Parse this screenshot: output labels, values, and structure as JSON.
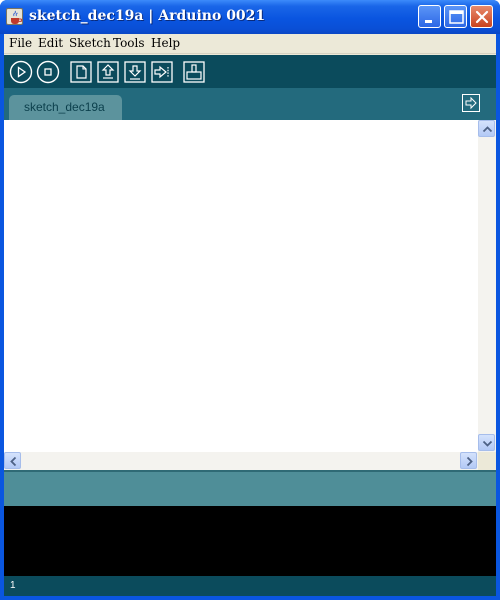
{
  "window": {
    "title": "sketch_dec19a | Arduino 0021"
  },
  "menu": {
    "items": [
      {
        "label": "File"
      },
      {
        "label": "Edit"
      },
      {
        "label": "Sketch"
      },
      {
        "label": "Tools"
      },
      {
        "label": "Help"
      }
    ]
  },
  "toolbar": {
    "icons": [
      "verify-icon",
      "stop-icon",
      "new-icon",
      "open-icon",
      "save-icon",
      "upload-icon",
      "serial-monitor-icon"
    ]
  },
  "tabs": [
    {
      "label": "sketch_dec19a"
    }
  ],
  "editor": {
    "content": ""
  },
  "console": {
    "text": ""
  },
  "line_indicator": {
    "value": "1"
  },
  "colors": {
    "toolbar_bg": "#0b4b5c",
    "tabbar_bg": "#236a7d",
    "tab_bg": "#5c939d",
    "status_bg": "#4f8e98",
    "console_bg": "#000000",
    "titlebar": "#0a55e0"
  }
}
